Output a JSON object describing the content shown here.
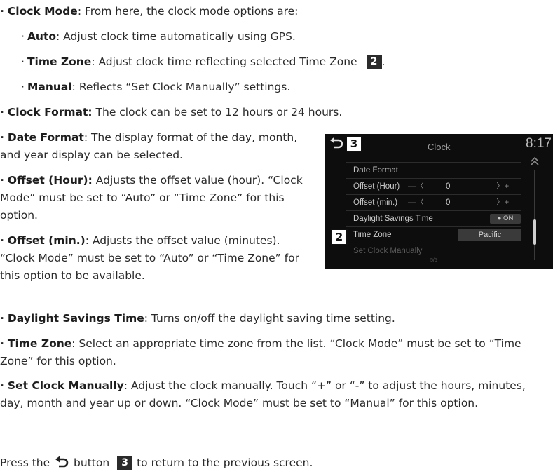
{
  "bullets": {
    "clock_mode": {
      "term": "Clock Mode",
      "text": ": From here, the clock mode options are:"
    },
    "auto": {
      "term": "Auto",
      "text": ": Adjust clock time automatically using GPS."
    },
    "time_zone_opt": {
      "term": "Time Zone",
      "text": ": Adjust clock time reflecting selected Time Zone",
      "badge": "2",
      "end": "."
    },
    "manual": {
      "term": "Manual",
      "text": ": Reflects “Set Clock Manually” settings."
    },
    "clock_format": {
      "term": "Clock Format:",
      "text": " The clock can be set to 12 hours or 24 hours."
    },
    "date_format": {
      "term": "Date Format",
      "text": ": The display format of the day, month, and year display can be selected."
    },
    "offset_hour": {
      "term": "Offset (Hour):",
      "text": " Adjusts the offset value (hour). “Clock Mode” must be set to “Auto” or “Time Zone” for this option."
    },
    "offset_min": {
      "term": "Offset (min.)",
      "text": ": Adjusts the offset value (minutes). “Clock Mode” must be set to “Auto” or “Time Zone” for this option to be available."
    },
    "dst": {
      "term": "Daylight Savings Time",
      "text": ": Turns on/off the daylight saving time setting."
    },
    "time_zone": {
      "term": "Time Zone",
      "text": ": Select an appropriate time zone from the list. “Clock Mode” must be set to “Time Zone” for this option."
    },
    "set_clock": {
      "term": "Set Clock Manually",
      "text": ": Adjust the clock manually. Touch “+” or “-” to adjust the hours, minutes, day, month and year up or down. “Clock Mode” must be set to “Manual” for this option."
    }
  },
  "footer": {
    "before": "Press the",
    "after_icon": "button",
    "badge": "3",
    "end": "to return to the previous screen."
  },
  "screen": {
    "title": "Clock",
    "time": "8:17",
    "back_badge": "3",
    "side_badge": "2",
    "rows": {
      "date_format": "Date Format",
      "offset_hour": "Offset (Hour)",
      "offset_hour_value": "0",
      "offset_min": "Offset (min.)",
      "offset_min_value": "0",
      "dst": "Daylight Savings Time",
      "dst_value": "● ON",
      "time_zone": "Time Zone",
      "time_zone_value": "Pacific",
      "set_clock": "Set Clock Manually",
      "page": "5/5"
    },
    "minus_glyph": "—〈",
    "plus_glyph": "〉+"
  }
}
